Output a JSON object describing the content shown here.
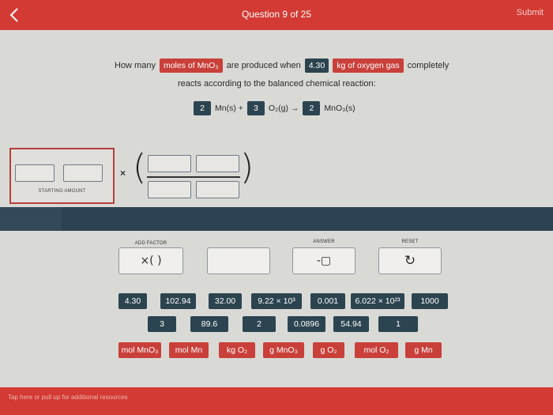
{
  "header": {
    "title": "Question 9 of 25",
    "submit_label": "Submit"
  },
  "question": {
    "pre": "How many",
    "unknown": "moles of MnO₃",
    "mid": "are produced when",
    "value": "4.30",
    "given": "kg of oxygen gas",
    "post": "completely",
    "line2": "reacts according to the balanced chemical reaction:"
  },
  "equation": {
    "coef1": "2",
    "sp1": "Mn(s) +",
    "coef2": "3",
    "sp2": "O₂(g) →",
    "coef3": "2",
    "sp3": "MnO₃(s)"
  },
  "workspace": {
    "starting_label": "STARTING AMOUNT",
    "times_sign": "×",
    "open_paren": "(",
    "close_paren": ")"
  },
  "controls": {
    "add_factor_label": "ADD FACTOR",
    "add_factor_glyph": "×( )",
    "answer_label": "ANSWER",
    "answer_glyph": "-▢",
    "reset_label": "RESET",
    "reset_glyph": "↻"
  },
  "keypad": {
    "row1": [
      "4.30",
      "102.94",
      "32.00",
      "9.22 × 10³",
      "0.001",
      "6.022 × 10²³",
      "1000"
    ],
    "row2": [
      "3",
      "89.6",
      "2",
      "0.0896",
      "54.94",
      "1"
    ],
    "units": [
      "mol MnO₃",
      "mol Mn",
      "kg O₂",
      "g MnO₃",
      "g O₂",
      "mol O₂",
      "g Mn"
    ]
  },
  "footer": {
    "hint": "Tap here or pull up for additional resources"
  },
  "colors": {
    "accent_red": "#d23a33",
    "dark_tag": "#2c4450",
    "background": "#d9d9d6"
  }
}
